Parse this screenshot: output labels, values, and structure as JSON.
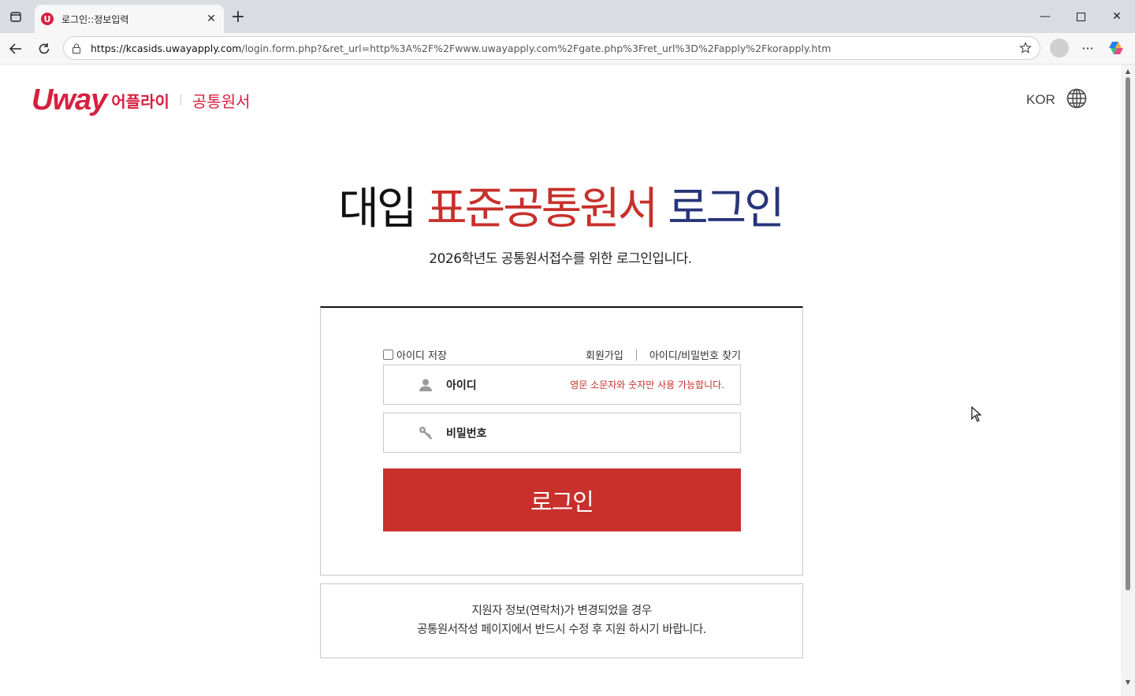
{
  "browser": {
    "tab_title": "로그인::정보입력",
    "url_host": "https://kcasids.uwayapply.com",
    "url_path": "/login.form.php?&ret_url=http%3A%2F%2Fwww.uwayapply.com%2Fgate.php%3Fret_url%3D%2Fapply%2Fkorapply.htm"
  },
  "header": {
    "logo_text": "Uway",
    "logo_apply": "어플라이",
    "logo_sub": "공통원서",
    "lang_label": "KOR"
  },
  "main": {
    "title_part1": "대입 ",
    "title_part2": "표준공통원서 ",
    "title_part3": "로그인",
    "subtitle": "2026학년도 공통원서접수를 위한 로그인입니다.",
    "save_id_label": "아이디 저장",
    "signup_link": "회원가입",
    "find_link": "아이디/비밀번호 찾기",
    "id_label": "아이디",
    "id_hint": "영문 소문자와 숫자만 사용 가능합니다.",
    "pw_label": "비밀번호",
    "login_button": "로그인",
    "notice_line1": "지원자 정보(연락처)가 변경되었을 경우",
    "notice_line2": "공통원서작성 페이지에서 반드시 수정 후 지원 하시기 바랍니다."
  },
  "colors": {
    "brand_red": "#c8302b",
    "logo_red": "#d6203f",
    "navy": "#28357a"
  }
}
